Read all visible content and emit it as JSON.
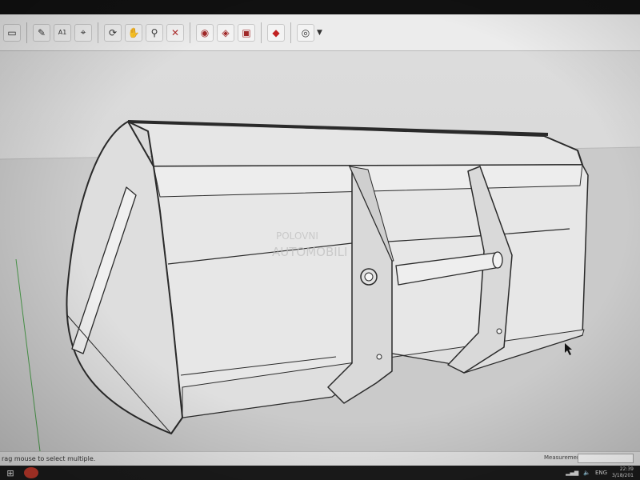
{
  "toolbar": {
    "tools": [
      {
        "name": "select-tool",
        "glyph": "▭"
      },
      {
        "name": "paint-tool",
        "glyph": "✎"
      },
      {
        "name": "text-tool",
        "glyph": "A1"
      },
      {
        "name": "tape-tool",
        "glyph": "⌖"
      },
      {
        "name": "orbit-tool",
        "glyph": "⟳"
      },
      {
        "name": "pan-tool",
        "glyph": "✋"
      },
      {
        "name": "zoom-tool",
        "glyph": "⚲"
      },
      {
        "name": "zoom-extents-tool",
        "glyph": "✕"
      },
      {
        "name": "warehouse-tool",
        "glyph": "◉"
      },
      {
        "name": "components-tool",
        "glyph": "◈"
      },
      {
        "name": "extension-tool",
        "glyph": "▣"
      },
      {
        "name": "ruby-tool",
        "glyph": "◆"
      },
      {
        "name": "account-tool",
        "glyph": "◎"
      }
    ]
  },
  "status": {
    "hint": "rag mouse to select multiple.",
    "measurements_label": "Measurements"
  },
  "taskbar": {
    "lang": "ENG",
    "time": "22:39",
    "date": "3/18/201"
  },
  "watermark": {
    "line1": "POLOVNI",
    "line2": "AUTOMOBILI"
  },
  "colors": {
    "toolbar_bg": "#ececec",
    "viewport_sky": "#d8d8d8",
    "viewport_ground": "#c9c9c9",
    "model_face": "#e9e9e9",
    "model_shadow": "#d2d2d2",
    "edge": "#2a2a2a"
  }
}
